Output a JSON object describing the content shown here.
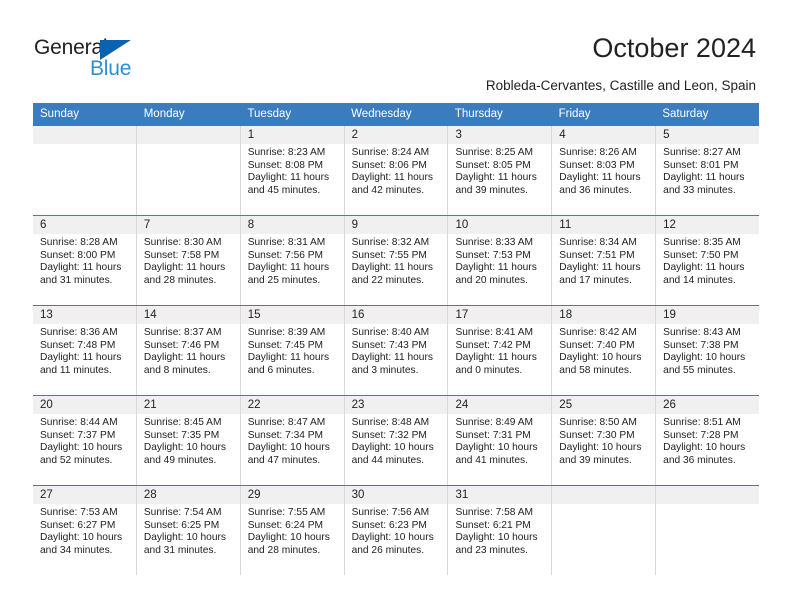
{
  "brand": {
    "name_part1": "General",
    "name_part2": "Blue",
    "triangle_color": "#0a62b0",
    "blue_color": "#2d8fd5"
  },
  "header": {
    "title": "October 2024",
    "subtitle": "Robleda-Cervantes, Castille and Leon, Spain"
  },
  "theme": {
    "header_bar": "#3b7cbe",
    "day_band": "#f0f0f0",
    "grid_line": "#d9d9d9",
    "row_line": "#3b7cbe"
  },
  "weekdays": [
    "Sunday",
    "Monday",
    "Tuesday",
    "Wednesday",
    "Thursday",
    "Friday",
    "Saturday"
  ],
  "weeks": [
    [
      {
        "day": "",
        "sunrise": "",
        "sunset": "",
        "daylight_l1": "",
        "daylight_l2": ""
      },
      {
        "day": "",
        "sunrise": "",
        "sunset": "",
        "daylight_l1": "",
        "daylight_l2": ""
      },
      {
        "day": "1",
        "sunrise": "Sunrise: 8:23 AM",
        "sunset": "Sunset: 8:08 PM",
        "daylight_l1": "Daylight: 11 hours",
        "daylight_l2": "and 45 minutes."
      },
      {
        "day": "2",
        "sunrise": "Sunrise: 8:24 AM",
        "sunset": "Sunset: 8:06 PM",
        "daylight_l1": "Daylight: 11 hours",
        "daylight_l2": "and 42 minutes."
      },
      {
        "day": "3",
        "sunrise": "Sunrise: 8:25 AM",
        "sunset": "Sunset: 8:05 PM",
        "daylight_l1": "Daylight: 11 hours",
        "daylight_l2": "and 39 minutes."
      },
      {
        "day": "4",
        "sunrise": "Sunrise: 8:26 AM",
        "sunset": "Sunset: 8:03 PM",
        "daylight_l1": "Daylight: 11 hours",
        "daylight_l2": "and 36 minutes."
      },
      {
        "day": "5",
        "sunrise": "Sunrise: 8:27 AM",
        "sunset": "Sunset: 8:01 PM",
        "daylight_l1": "Daylight: 11 hours",
        "daylight_l2": "and 33 minutes."
      }
    ],
    [
      {
        "day": "6",
        "sunrise": "Sunrise: 8:28 AM",
        "sunset": "Sunset: 8:00 PM",
        "daylight_l1": "Daylight: 11 hours",
        "daylight_l2": "and 31 minutes."
      },
      {
        "day": "7",
        "sunrise": "Sunrise: 8:30 AM",
        "sunset": "Sunset: 7:58 PM",
        "daylight_l1": "Daylight: 11 hours",
        "daylight_l2": "and 28 minutes."
      },
      {
        "day": "8",
        "sunrise": "Sunrise: 8:31 AM",
        "sunset": "Sunset: 7:56 PM",
        "daylight_l1": "Daylight: 11 hours",
        "daylight_l2": "and 25 minutes."
      },
      {
        "day": "9",
        "sunrise": "Sunrise: 8:32 AM",
        "sunset": "Sunset: 7:55 PM",
        "daylight_l1": "Daylight: 11 hours",
        "daylight_l2": "and 22 minutes."
      },
      {
        "day": "10",
        "sunrise": "Sunrise: 8:33 AM",
        "sunset": "Sunset: 7:53 PM",
        "daylight_l1": "Daylight: 11 hours",
        "daylight_l2": "and 20 minutes."
      },
      {
        "day": "11",
        "sunrise": "Sunrise: 8:34 AM",
        "sunset": "Sunset: 7:51 PM",
        "daylight_l1": "Daylight: 11 hours",
        "daylight_l2": "and 17 minutes."
      },
      {
        "day": "12",
        "sunrise": "Sunrise: 8:35 AM",
        "sunset": "Sunset: 7:50 PM",
        "daylight_l1": "Daylight: 11 hours",
        "daylight_l2": "and 14 minutes."
      }
    ],
    [
      {
        "day": "13",
        "sunrise": "Sunrise: 8:36 AM",
        "sunset": "Sunset: 7:48 PM",
        "daylight_l1": "Daylight: 11 hours",
        "daylight_l2": "and 11 minutes."
      },
      {
        "day": "14",
        "sunrise": "Sunrise: 8:37 AM",
        "sunset": "Sunset: 7:46 PM",
        "daylight_l1": "Daylight: 11 hours",
        "daylight_l2": "and 8 minutes."
      },
      {
        "day": "15",
        "sunrise": "Sunrise: 8:39 AM",
        "sunset": "Sunset: 7:45 PM",
        "daylight_l1": "Daylight: 11 hours",
        "daylight_l2": "and 6 minutes."
      },
      {
        "day": "16",
        "sunrise": "Sunrise: 8:40 AM",
        "sunset": "Sunset: 7:43 PM",
        "daylight_l1": "Daylight: 11 hours",
        "daylight_l2": "and 3 minutes."
      },
      {
        "day": "17",
        "sunrise": "Sunrise: 8:41 AM",
        "sunset": "Sunset: 7:42 PM",
        "daylight_l1": "Daylight: 11 hours",
        "daylight_l2": "and 0 minutes."
      },
      {
        "day": "18",
        "sunrise": "Sunrise: 8:42 AM",
        "sunset": "Sunset: 7:40 PM",
        "daylight_l1": "Daylight: 10 hours",
        "daylight_l2": "and 58 minutes."
      },
      {
        "day": "19",
        "sunrise": "Sunrise: 8:43 AM",
        "sunset": "Sunset: 7:38 PM",
        "daylight_l1": "Daylight: 10 hours",
        "daylight_l2": "and 55 minutes."
      }
    ],
    [
      {
        "day": "20",
        "sunrise": "Sunrise: 8:44 AM",
        "sunset": "Sunset: 7:37 PM",
        "daylight_l1": "Daylight: 10 hours",
        "daylight_l2": "and 52 minutes."
      },
      {
        "day": "21",
        "sunrise": "Sunrise: 8:45 AM",
        "sunset": "Sunset: 7:35 PM",
        "daylight_l1": "Daylight: 10 hours",
        "daylight_l2": "and 49 minutes."
      },
      {
        "day": "22",
        "sunrise": "Sunrise: 8:47 AM",
        "sunset": "Sunset: 7:34 PM",
        "daylight_l1": "Daylight: 10 hours",
        "daylight_l2": "and 47 minutes."
      },
      {
        "day": "23",
        "sunrise": "Sunrise: 8:48 AM",
        "sunset": "Sunset: 7:32 PM",
        "daylight_l1": "Daylight: 10 hours",
        "daylight_l2": "and 44 minutes."
      },
      {
        "day": "24",
        "sunrise": "Sunrise: 8:49 AM",
        "sunset": "Sunset: 7:31 PM",
        "daylight_l1": "Daylight: 10 hours",
        "daylight_l2": "and 41 minutes."
      },
      {
        "day": "25",
        "sunrise": "Sunrise: 8:50 AM",
        "sunset": "Sunset: 7:30 PM",
        "daylight_l1": "Daylight: 10 hours",
        "daylight_l2": "and 39 minutes."
      },
      {
        "day": "26",
        "sunrise": "Sunrise: 8:51 AM",
        "sunset": "Sunset: 7:28 PM",
        "daylight_l1": "Daylight: 10 hours",
        "daylight_l2": "and 36 minutes."
      }
    ],
    [
      {
        "day": "27",
        "sunrise": "Sunrise: 7:53 AM",
        "sunset": "Sunset: 6:27 PM",
        "daylight_l1": "Daylight: 10 hours",
        "daylight_l2": "and 34 minutes."
      },
      {
        "day": "28",
        "sunrise": "Sunrise: 7:54 AM",
        "sunset": "Sunset: 6:25 PM",
        "daylight_l1": "Daylight: 10 hours",
        "daylight_l2": "and 31 minutes."
      },
      {
        "day": "29",
        "sunrise": "Sunrise: 7:55 AM",
        "sunset": "Sunset: 6:24 PM",
        "daylight_l1": "Daylight: 10 hours",
        "daylight_l2": "and 28 minutes."
      },
      {
        "day": "30",
        "sunrise": "Sunrise: 7:56 AM",
        "sunset": "Sunset: 6:23 PM",
        "daylight_l1": "Daylight: 10 hours",
        "daylight_l2": "and 26 minutes."
      },
      {
        "day": "31",
        "sunrise": "Sunrise: 7:58 AM",
        "sunset": "Sunset: 6:21 PM",
        "daylight_l1": "Daylight: 10 hours",
        "daylight_l2": "and 23 minutes."
      },
      {
        "day": "",
        "sunrise": "",
        "sunset": "",
        "daylight_l1": "",
        "daylight_l2": ""
      },
      {
        "day": "",
        "sunrise": "",
        "sunset": "",
        "daylight_l1": "",
        "daylight_l2": ""
      }
    ]
  ]
}
